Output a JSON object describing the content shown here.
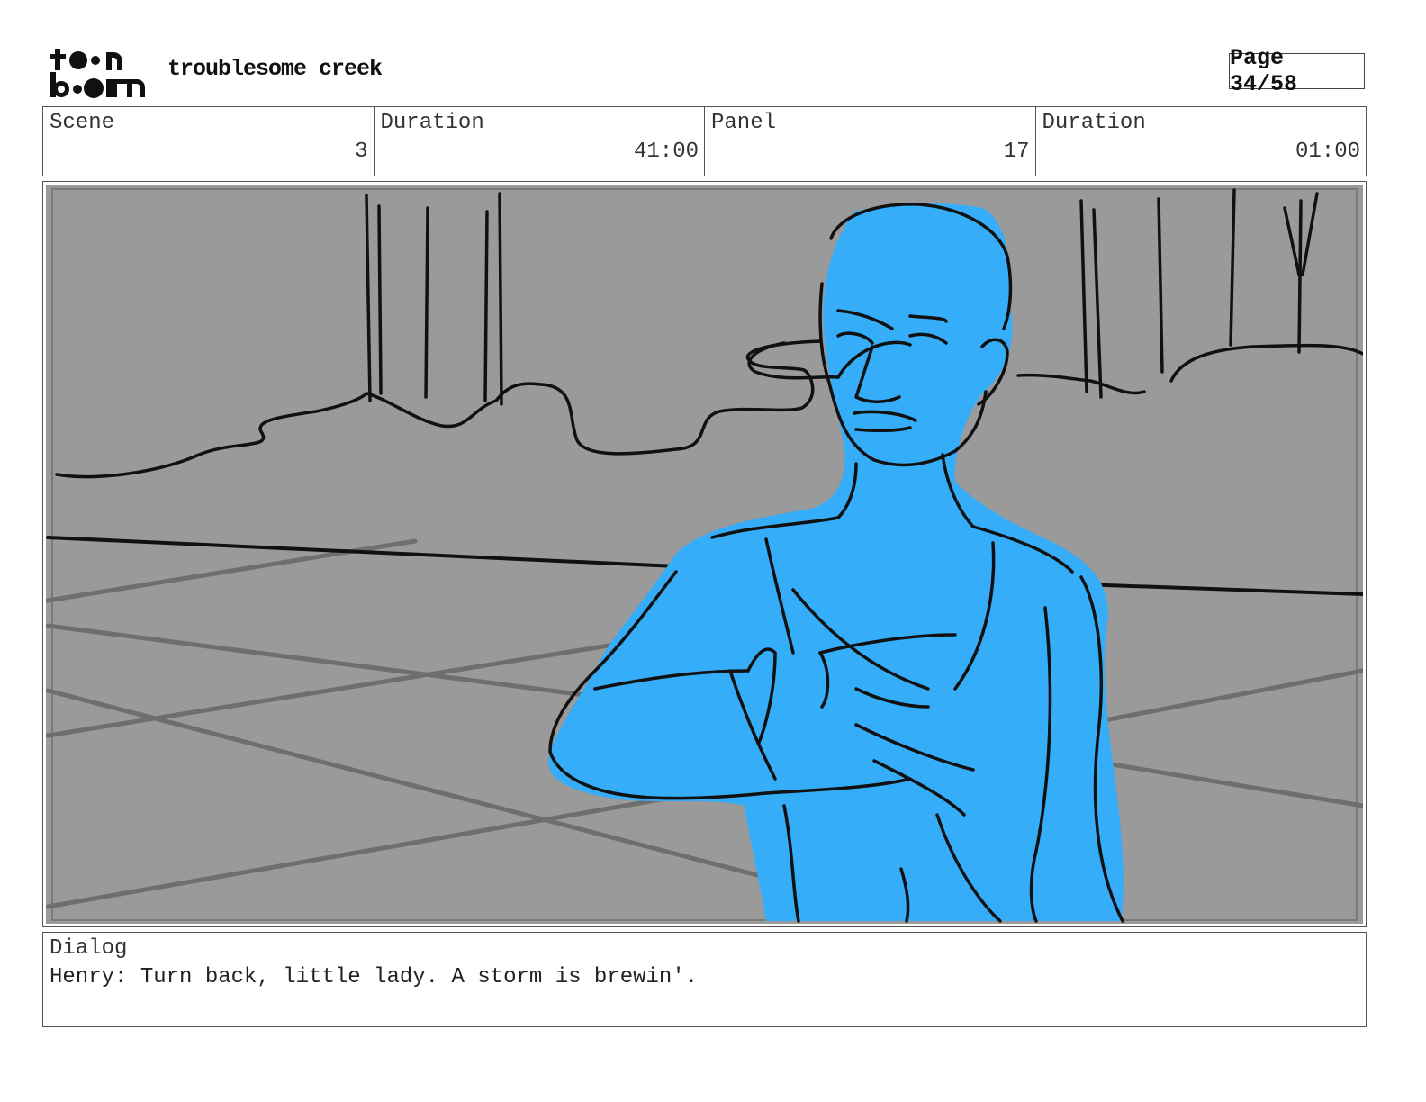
{
  "header": {
    "logo_text": "toon boom",
    "doc_title": "troublesome creek",
    "page_label": "Page 34/58"
  },
  "info": [
    {
      "label": "Scene",
      "value": "3"
    },
    {
      "label": "Duration",
      "value": "41:00"
    },
    {
      "label": "Panel",
      "value": "17"
    },
    {
      "label": "Duration",
      "value": "01:00"
    }
  ],
  "panel": {
    "sketch_colors": {
      "background": "#9a9a9a",
      "figure": "#35adf8",
      "ink": "#111111",
      "floor_lines": "#6f6f6f"
    }
  },
  "dialog": {
    "label": "Dialog",
    "text": "Henry: Turn back, little lady. A storm is brewin'."
  }
}
